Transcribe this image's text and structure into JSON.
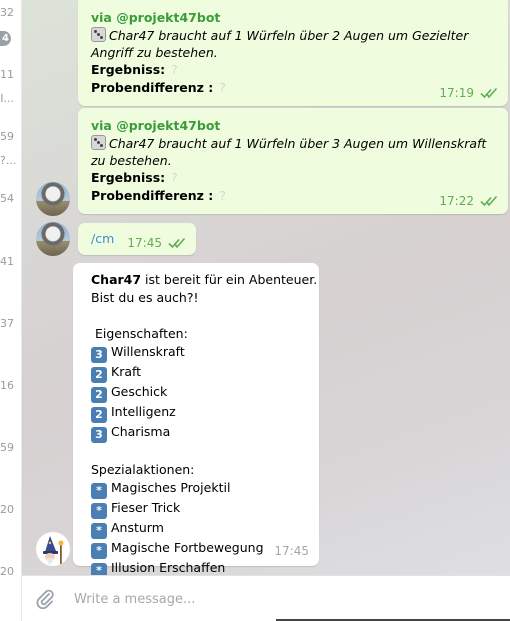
{
  "chat_list_fragments": [
    {
      "text": "32",
      "badge": false
    },
    {
      "text": "4",
      "badge": true
    },
    {
      "text": "11",
      "badge": false
    },
    {
      "text": "I...",
      "badge": false
    },
    {
      "text": "59",
      "badge": false
    },
    {
      "text": "?...",
      "badge": false
    },
    {
      "text": "54",
      "badge": false
    },
    {
      "text": "41",
      "badge": false
    },
    {
      "text": "37",
      "badge": false
    },
    {
      "text": "16",
      "badge": false
    },
    {
      "text": "59",
      "badge": false
    },
    {
      "text": "20",
      "badge": false
    },
    {
      "text": "20",
      "badge": false
    }
  ],
  "messages": [
    {
      "via": "via @projekt47bot",
      "text": "Char47 braucht auf 1 Würfeln über 2 Augen um Gezielter Angriff zu bestehen.",
      "result_label": "Ergebniss:",
      "result_value": "?",
      "diff_label": "Probendifferenz :",
      "diff_value": "?",
      "time": "17:19"
    },
    {
      "via": "via @projekt47bot",
      "text": "Char47 braucht auf 1 Würfeln über 3 Augen um Willenskraft zu bestehen.",
      "result_label": "Ergebniss:",
      "result_value": "?",
      "diff_label": "Probendifferenz :",
      "diff_value": "?",
      "time": "17:22"
    },
    {
      "command": "/cm",
      "time": "17:45"
    },
    {
      "name": "Char47",
      "intro_rest": " ist bereit für ein Abenteuer.",
      "intro_line2": "Bist du es auch?!",
      "attributes_heading": "Eigenschaften:",
      "attributes": [
        {
          "value": "3",
          "name": "Willenskraft"
        },
        {
          "value": "2",
          "name": "Kraft"
        },
        {
          "value": "2",
          "name": "Geschick"
        },
        {
          "value": "2",
          "name": "Intelligenz"
        },
        {
          "value": "3",
          "name": "Charisma"
        }
      ],
      "actions_heading": "Spezialaktionen:",
      "actions": [
        {
          "symbol": "*",
          "name": "Magisches Projektil"
        },
        {
          "symbol": "*",
          "name": "Fieser Trick"
        },
        {
          "symbol": "*",
          "name": "Ansturm"
        },
        {
          "symbol": "*",
          "name": "Magische Fortbewegung"
        },
        {
          "symbol": "*",
          "name": "Illusion Erschaffen"
        }
      ],
      "time": "17:45"
    }
  ],
  "composer": {
    "placeholder": "Write a message..."
  },
  "colors": {
    "outgoing_bubble": "#effdde",
    "incoming_bubble": "#ffffff",
    "via_green": "#3a9c3a",
    "time_green": "#62ac55",
    "keycap_blue": "#4a7fb4"
  }
}
